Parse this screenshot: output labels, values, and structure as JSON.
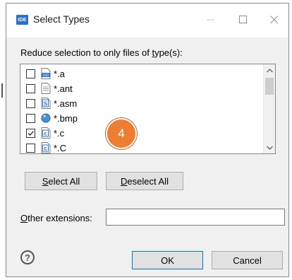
{
  "window": {
    "app_icon_text": "IDE",
    "title": "Select Types",
    "minimize_icon": "minimize-icon",
    "maximize_icon": "maximize-icon",
    "close_icon": "close-icon"
  },
  "prompt": {
    "prefix": "Reduce selection to only files of ",
    "mnemonic": "t",
    "suffix": "ype(s):"
  },
  "file_types": [
    {
      "label": "*.a",
      "checked": false,
      "icon": "binary-file-icon"
    },
    {
      "label": "*.ant",
      "checked": false,
      "icon": "text-file-icon"
    },
    {
      "label": "*.asm",
      "checked": false,
      "icon": "assembly-file-icon"
    },
    {
      "label": "*.bmp",
      "checked": false,
      "icon": "image-globe-icon"
    },
    {
      "label": "*.c",
      "checked": true,
      "icon": "c-source-file-icon"
    },
    {
      "label": "*.C",
      "checked": false,
      "icon": "c-source-file-icon"
    }
  ],
  "buttons": {
    "select_all": {
      "mnemonic": "S",
      "rest": "elect All"
    },
    "deselect_all": {
      "mnemonic": "D",
      "rest": "eselect All"
    },
    "ok": "OK",
    "cancel": "Cancel"
  },
  "other_extensions": {
    "mnemonic": "O",
    "rest": "ther extensions:",
    "value": ""
  },
  "help_icon": "help-icon",
  "help_glyph": "?",
  "callout": {
    "number": "4",
    "color": "#ed7d31"
  },
  "colors": {
    "accent": "#0078d7",
    "file_icon_blue": "#2a6fd6"
  }
}
